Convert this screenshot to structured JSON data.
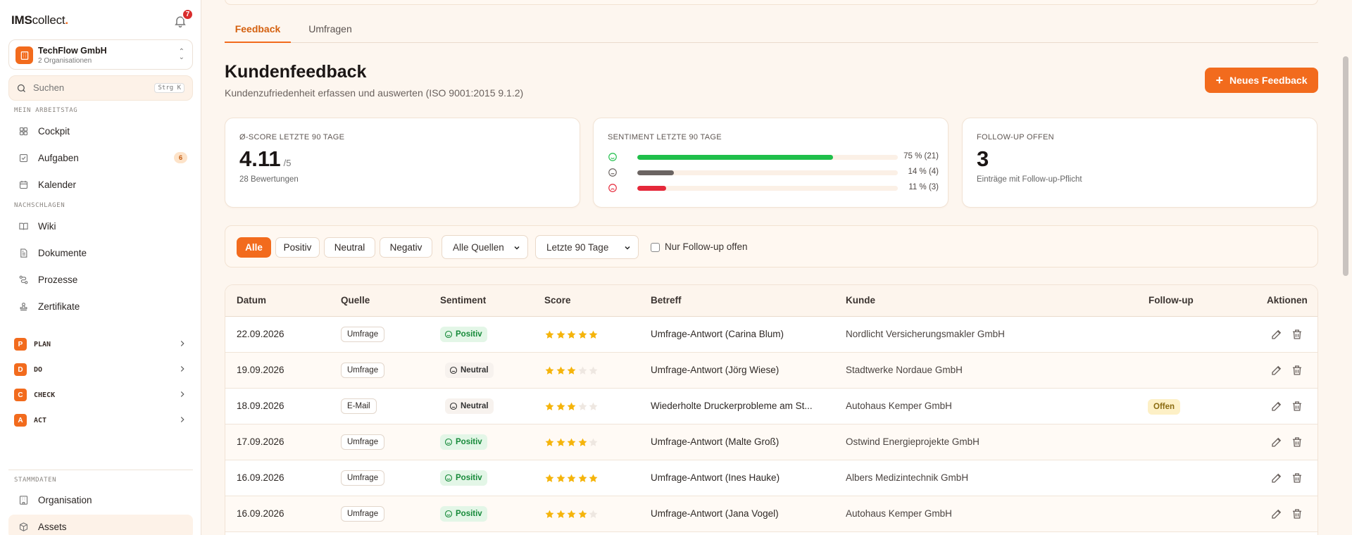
{
  "app": {
    "logo": {
      "bold": "IMS",
      "light": "collect",
      "dot": "."
    },
    "notifications_count": "7"
  },
  "org": {
    "name": "TechFlow GmbH",
    "sub": "2 Organisationen"
  },
  "search": {
    "placeholder": "Suchen",
    "shortcut": "Strg K"
  },
  "sidebar": {
    "section_work": "MEIN ARBEITSTAG",
    "section_lookup": "NACHSCHLAGEN",
    "section_master": "STAMMDATEN",
    "work_items": [
      {
        "label": "Cockpit",
        "icon": "grid-icon"
      },
      {
        "label": "Aufgaben",
        "icon": "checkbox-icon",
        "badge": "6"
      },
      {
        "label": "Kalender",
        "icon": "calendar-icon"
      }
    ],
    "lookup_items": [
      {
        "label": "Wiki",
        "icon": "book-icon"
      },
      {
        "label": "Dokumente",
        "icon": "document-icon"
      },
      {
        "label": "Prozesse",
        "icon": "workflow-icon"
      },
      {
        "label": "Zertifikate",
        "icon": "stamp-icon"
      }
    ],
    "pdca": [
      {
        "letter": "P",
        "label": "PLAN"
      },
      {
        "letter": "D",
        "label": "DO"
      },
      {
        "letter": "C",
        "label": "CHECK"
      },
      {
        "letter": "A",
        "label": "ACT"
      }
    ],
    "master_items": [
      {
        "label": "Organisation",
        "icon": "building-icon"
      },
      {
        "label": "Assets",
        "icon": "box-icon"
      }
    ]
  },
  "tabs": [
    "Feedback",
    "Umfragen"
  ],
  "page": {
    "title": "Kundenfeedback",
    "subtitle": "Kundenzufriedenheit erfassen und auswerten (ISO 9001:2015 9.1.2)",
    "new_button": "Neues Feedback"
  },
  "cards": {
    "score": {
      "title": "Ø-SCORE LETZTE 90 TAGE",
      "value": "4.11",
      "unit": "/5",
      "sub": "28 Bewertungen"
    },
    "sentiment": {
      "title": "SENTIMENT LETZTE 90 TAGE",
      "rows": [
        {
          "label": "75 % (21)",
          "fraction": 0.75,
          "color": "#1fbf4a"
        },
        {
          "label": "14 % (4)",
          "fraction": 0.14,
          "color": "#6b6462"
        },
        {
          "label": "11 % (3)",
          "fraction": 0.11,
          "color": "#e5283a"
        }
      ]
    },
    "followup": {
      "title": "FOLLOW-UP OFFEN",
      "value": "3",
      "sub": "Einträge mit Follow-up-Pflicht"
    }
  },
  "filters": {
    "chips": [
      "Alle",
      "Positiv",
      "Neutral",
      "Negativ"
    ],
    "source_select": "Alle Quellen",
    "period_select": "Letzte 90 Tage",
    "followup_checkbox": "Nur Follow-up offen"
  },
  "table": {
    "headers": [
      "Datum",
      "Quelle",
      "Sentiment",
      "Score",
      "Betreff",
      "Kunde",
      "Follow-up",
      "Aktionen"
    ],
    "rows": [
      {
        "date": "22.09.2026",
        "source": "Umfrage",
        "sentiment": "Positiv",
        "score": 5,
        "subject": "Umfrage-Antwort (Carina Blum)",
        "customer": "Nordlicht Versicherungsmakler GmbH",
        "followup": ""
      },
      {
        "date": "19.09.2026",
        "source": "Umfrage",
        "sentiment": "Neutral",
        "score": 3,
        "subject": "Umfrage-Antwort (Jörg Wiese)",
        "customer": "Stadtwerke Nordaue GmbH",
        "followup": ""
      },
      {
        "date": "18.09.2026",
        "source": "E-Mail",
        "sentiment": "Neutral",
        "score": 3,
        "subject": "Wiederholte Druckerprobleme am St...",
        "customer": "Autohaus Kemper GmbH",
        "followup": "Offen"
      },
      {
        "date": "17.09.2026",
        "source": "Umfrage",
        "sentiment": "Positiv",
        "score": 4,
        "subject": "Umfrage-Antwort (Malte Groß)",
        "customer": "Ostwind Energieprojekte GmbH",
        "followup": ""
      },
      {
        "date": "16.09.2026",
        "source": "Umfrage",
        "sentiment": "Positiv",
        "score": 5,
        "subject": "Umfrage-Antwort (Ines Hauke)",
        "customer": "Albers Medizintechnik GmbH",
        "followup": ""
      },
      {
        "date": "16.09.2026",
        "source": "Umfrage",
        "sentiment": "Positiv",
        "score": 4,
        "subject": "Umfrage-Antwort (Jana Vogel)",
        "customer": "Autohaus Kemper GmbH",
        "followup": ""
      }
    ]
  },
  "colors": {
    "accent": "#f26b1d",
    "star": "#f5b40b",
    "star_empty": "#eee7e1"
  }
}
